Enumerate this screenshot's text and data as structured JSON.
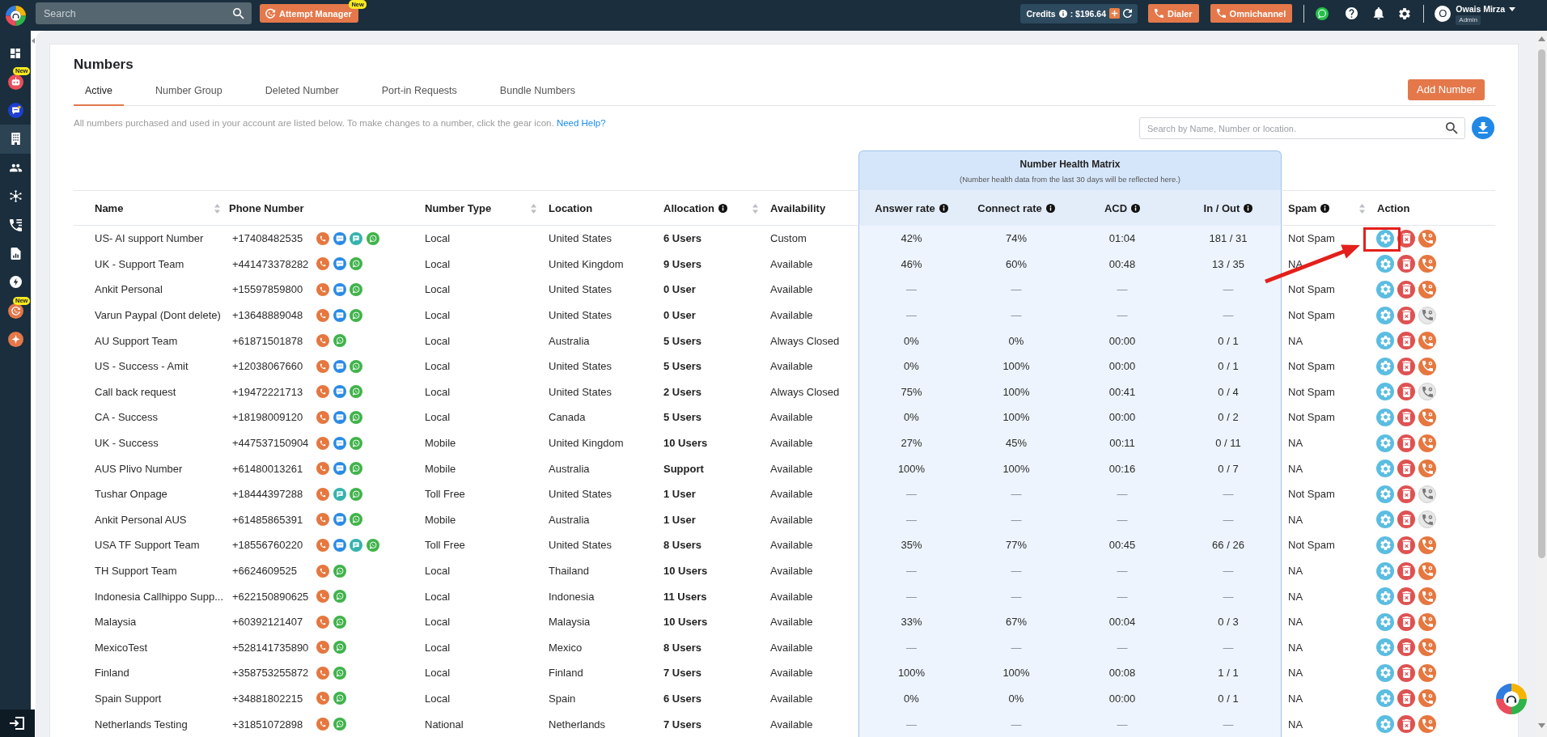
{
  "topbar": {
    "search": {
      "placeholder": "Search"
    },
    "attempt_manager": {
      "label": "Attempt Manager",
      "badge": "New"
    },
    "credits": {
      "label": "Credits",
      "amount": ": $196.64"
    },
    "buttons": [
      {
        "label": "Dialer"
      },
      {
        "label": "Omnichannel"
      }
    ],
    "user": {
      "initial": "O",
      "name": "Owais Mirza",
      "role": "Admin"
    }
  },
  "sidebar": {
    "items": [
      {
        "kind": "dashboard",
        "selected": false
      },
      {
        "kind": "bot",
        "selected": false,
        "badge": "New"
      },
      {
        "kind": "chat",
        "selected": false
      },
      {
        "kind": "building",
        "selected": true
      },
      {
        "kind": "people",
        "selected": false
      },
      {
        "kind": "network",
        "selected": false
      },
      {
        "kind": "phone-list",
        "selected": false
      },
      {
        "kind": "report",
        "selected": false
      },
      {
        "kind": "bolt",
        "selected": false
      },
      {
        "kind": "attempt",
        "selected": false,
        "badge": "New"
      },
      {
        "kind": "sparkle",
        "selected": false
      }
    ]
  },
  "page": {
    "title": "Numbers",
    "tabs": [
      {
        "label": "Active",
        "selected": true
      },
      {
        "label": "Number Group",
        "selected": false
      },
      {
        "label": "Deleted Number",
        "selected": false
      },
      {
        "label": "Port-in Requests",
        "selected": false
      },
      {
        "label": "Bundle Numbers",
        "selected": false
      }
    ],
    "add_button": "Add Number",
    "description": "All numbers purchased and used in your account are listed below. To make changes to a number, click the gear icon.",
    "help_link": "Need Help?",
    "search": {
      "placeholder": "Search by Name, Number or location."
    }
  },
  "health_matrix": {
    "title": "Number Health Matrix",
    "subtitle": "(Number health data from the last 30 days will be reflected here.)"
  },
  "table": {
    "columns": [
      {
        "label": "Name",
        "sortable": true,
        "info": false,
        "kind": "standard"
      },
      {
        "label": "Phone Number",
        "sortable": false,
        "info": false,
        "kind": "standard"
      },
      {
        "label": "Number Type",
        "sortable": true,
        "info": false,
        "kind": "standard"
      },
      {
        "label": "Location",
        "sortable": false,
        "info": false,
        "kind": "standard"
      },
      {
        "label": "Allocation",
        "sortable": true,
        "info": true,
        "kind": "standard"
      },
      {
        "label": "Availability",
        "sortable": false,
        "info": false,
        "kind": "standard"
      },
      {
        "label": "Answer rate",
        "sortable": false,
        "info": true,
        "kind": "health"
      },
      {
        "label": "Connect rate",
        "sortable": false,
        "info": true,
        "kind": "health"
      },
      {
        "label": "ACD",
        "sortable": false,
        "info": true,
        "kind": "health"
      },
      {
        "label": "In / Out",
        "sortable": false,
        "info": true,
        "kind": "health"
      },
      {
        "label": "Spam",
        "sortable": true,
        "info": true,
        "kind": "standard"
      },
      {
        "label": "Action",
        "sortable": false,
        "info": false,
        "kind": "standard"
      }
    ],
    "rows": [
      {
        "name": "US- AI support Number",
        "phone": "+17408482535",
        "channels": [
          {
            "kind": "call"
          },
          {
            "kind": "sms"
          },
          {
            "kind": "chat"
          },
          {
            "kind": "whatsapp"
          }
        ],
        "number_type": "Local",
        "location": "United States",
        "allocation": "6 Users",
        "availability": "Custom",
        "health_data": true,
        "answer_rate": "42%",
        "connect_rate": "74%",
        "acd": "01:04",
        "in_out": "181 / 31",
        "spam": "Not Spam",
        "forwarding": true,
        "highlighted": true
      },
      {
        "name": "UK - Support Team",
        "phone": "+441473378282",
        "channels": [
          {
            "kind": "call"
          },
          {
            "kind": "sms"
          },
          {
            "kind": "whatsapp"
          }
        ],
        "number_type": "Local",
        "location": "United Kingdom",
        "allocation": "9 Users",
        "availability": "Available",
        "health_data": true,
        "answer_rate": "46%",
        "connect_rate": "60%",
        "acd": "00:48",
        "in_out": "13 / 35",
        "spam": "NA",
        "forwarding": true,
        "highlighted": false
      },
      {
        "name": "Ankit Personal",
        "phone": "+15597859800",
        "channels": [
          {
            "kind": "call"
          },
          {
            "kind": "sms"
          },
          {
            "kind": "whatsapp"
          }
        ],
        "number_type": "Local",
        "location": "United States",
        "allocation": "0 User",
        "availability": "Available",
        "health_data": false,
        "answer_rate": "—",
        "connect_rate": "—",
        "acd": "—",
        "in_out": "—",
        "spam": "Not Spam",
        "forwarding": true,
        "highlighted": false
      },
      {
        "name": "Varun Paypal (Dont delete)",
        "phone": "+13648889048",
        "channels": [
          {
            "kind": "call"
          },
          {
            "kind": "sms"
          },
          {
            "kind": "whatsapp"
          }
        ],
        "number_type": "Local",
        "location": "United States",
        "allocation": "0 User",
        "availability": "Available",
        "health_data": false,
        "answer_rate": "—",
        "connect_rate": "—",
        "acd": "—",
        "in_out": "—",
        "spam": "Not Spam",
        "forwarding": false,
        "highlighted": false
      },
      {
        "name": "AU Support Team",
        "phone": "+61871501878",
        "channels": [
          {
            "kind": "call"
          },
          {
            "kind": "whatsapp"
          }
        ],
        "number_type": "Local",
        "location": "Australia",
        "allocation": "5 Users",
        "availability": "Always Closed",
        "health_data": true,
        "answer_rate": "0%",
        "connect_rate": "0%",
        "acd": "00:00",
        "in_out": "0 / 1",
        "spam": "NA",
        "forwarding": true,
        "highlighted": false
      },
      {
        "name": "US - Success - Amit",
        "phone": "+12038067660",
        "channels": [
          {
            "kind": "call"
          },
          {
            "kind": "sms"
          },
          {
            "kind": "whatsapp"
          }
        ],
        "number_type": "Local",
        "location": "United States",
        "allocation": "5 Users",
        "availability": "Available",
        "health_data": true,
        "answer_rate": "0%",
        "connect_rate": "100%",
        "acd": "00:00",
        "in_out": "0 / 1",
        "spam": "Not Spam",
        "forwarding": true,
        "highlighted": false
      },
      {
        "name": "Call back request",
        "phone": "+19472221713",
        "channels": [
          {
            "kind": "call"
          },
          {
            "kind": "sms"
          },
          {
            "kind": "whatsapp"
          }
        ],
        "number_type": "Local",
        "location": "United States",
        "allocation": "2 Users",
        "availability": "Always Closed",
        "health_data": true,
        "answer_rate": "75%",
        "connect_rate": "100%",
        "acd": "00:41",
        "in_out": "0 / 4",
        "spam": "Not Spam",
        "forwarding": false,
        "highlighted": false
      },
      {
        "name": "CA - Success",
        "phone": "+18198009120",
        "channels": [
          {
            "kind": "call"
          },
          {
            "kind": "sms"
          },
          {
            "kind": "whatsapp"
          }
        ],
        "number_type": "Local",
        "location": "Canada",
        "allocation": "5 Users",
        "availability": "Available",
        "health_data": true,
        "answer_rate": "0%",
        "connect_rate": "100%",
        "acd": "00:00",
        "in_out": "0 / 2",
        "spam": "Not Spam",
        "forwarding": true,
        "highlighted": false
      },
      {
        "name": "UK - Success",
        "phone": "+447537150904",
        "channels": [
          {
            "kind": "call"
          },
          {
            "kind": "sms"
          },
          {
            "kind": "whatsapp"
          }
        ],
        "number_type": "Mobile",
        "location": "United Kingdom",
        "allocation": "10 Users",
        "availability": "Available",
        "health_data": true,
        "answer_rate": "27%",
        "connect_rate": "45%",
        "acd": "00:11",
        "in_out": "0 / 11",
        "spam": "NA",
        "forwarding": true,
        "highlighted": false
      },
      {
        "name": "AUS Plivo Number",
        "phone": "+61480013261",
        "channels": [
          {
            "kind": "call"
          },
          {
            "kind": "sms"
          },
          {
            "kind": "whatsapp"
          }
        ],
        "number_type": "Mobile",
        "location": "Australia",
        "allocation": "Support",
        "availability": "Available",
        "health_data": true,
        "answer_rate": "100%",
        "connect_rate": "100%",
        "acd": "00:16",
        "in_out": "0 / 7",
        "spam": "NA",
        "forwarding": true,
        "highlighted": false
      },
      {
        "name": "Tushar Onpage",
        "phone": "+18444397288",
        "channels": [
          {
            "kind": "call"
          },
          {
            "kind": "chat"
          },
          {
            "kind": "whatsapp"
          }
        ],
        "number_type": "Toll Free",
        "location": "United States",
        "allocation": "1 User",
        "availability": "Available",
        "health_data": false,
        "answer_rate": "—",
        "connect_rate": "—",
        "acd": "—",
        "in_out": "—",
        "spam": "Not Spam",
        "forwarding": false,
        "highlighted": false
      },
      {
        "name": "Ankit Personal AUS",
        "phone": "+61485865391",
        "channels": [
          {
            "kind": "call"
          },
          {
            "kind": "sms"
          },
          {
            "kind": "whatsapp"
          }
        ],
        "number_type": "Mobile",
        "location": "Australia",
        "allocation": "1 User",
        "availability": "Available",
        "health_data": false,
        "answer_rate": "—",
        "connect_rate": "—",
        "acd": "—",
        "in_out": "—",
        "spam": "NA",
        "forwarding": false,
        "highlighted": false
      },
      {
        "name": "USA TF Support Team",
        "phone": "+18556760220",
        "channels": [
          {
            "kind": "call"
          },
          {
            "kind": "sms"
          },
          {
            "kind": "chat"
          },
          {
            "kind": "whatsapp"
          }
        ],
        "number_type": "Toll Free",
        "location": "United States",
        "allocation": "8 Users",
        "availability": "Available",
        "health_data": true,
        "answer_rate": "35%",
        "connect_rate": "77%",
        "acd": "00:45",
        "in_out": "66 / 26",
        "spam": "Not Spam",
        "forwarding": true,
        "highlighted": false
      },
      {
        "name": "TH Support Team",
        "phone": "+6624609525",
        "channels": [
          {
            "kind": "call"
          },
          {
            "kind": "whatsapp"
          }
        ],
        "number_type": "Local",
        "location": "Thailand",
        "allocation": "10 Users",
        "availability": "Available",
        "health_data": false,
        "answer_rate": "—",
        "connect_rate": "—",
        "acd": "—",
        "in_out": "—",
        "spam": "NA",
        "forwarding": true,
        "highlighted": false
      },
      {
        "name": "Indonesia Callhippo Supp...",
        "phone": "+622150890625",
        "channels": [
          {
            "kind": "call"
          },
          {
            "kind": "whatsapp"
          }
        ],
        "number_type": "Local",
        "location": "Indonesia",
        "allocation": "11 Users",
        "availability": "Available",
        "health_data": false,
        "answer_rate": "—",
        "connect_rate": "—",
        "acd": "—",
        "in_out": "—",
        "spam": "NA",
        "forwarding": true,
        "highlighted": false
      },
      {
        "name": "Malaysia",
        "phone": "+60392121407",
        "channels": [
          {
            "kind": "call"
          },
          {
            "kind": "whatsapp"
          }
        ],
        "number_type": "Local",
        "location": "Malaysia",
        "allocation": "10 Users",
        "availability": "Available",
        "health_data": true,
        "answer_rate": "33%",
        "connect_rate": "67%",
        "acd": "00:04",
        "in_out": "0 / 3",
        "spam": "NA",
        "forwarding": true,
        "highlighted": false
      },
      {
        "name": "MexicoTest",
        "phone": "+528141735890",
        "channels": [
          {
            "kind": "call"
          },
          {
            "kind": "whatsapp"
          }
        ],
        "number_type": "Local",
        "location": "Mexico",
        "allocation": "8 Users",
        "availability": "Available",
        "health_data": false,
        "answer_rate": "—",
        "connect_rate": "—",
        "acd": "—",
        "in_out": "—",
        "spam": "NA",
        "forwarding": true,
        "highlighted": false
      },
      {
        "name": "Finland",
        "phone": "+358753255872",
        "channels": [
          {
            "kind": "call"
          },
          {
            "kind": "whatsapp"
          }
        ],
        "number_type": "Local",
        "location": "Finland",
        "allocation": "7 Users",
        "availability": "Available",
        "health_data": true,
        "answer_rate": "100%",
        "connect_rate": "100%",
        "acd": "00:08",
        "in_out": "1 / 1",
        "spam": "NA",
        "forwarding": true,
        "highlighted": false
      },
      {
        "name": "Spain Support",
        "phone": "+34881802215",
        "channels": [
          {
            "kind": "call"
          },
          {
            "kind": "whatsapp"
          }
        ],
        "number_type": "Local",
        "location": "Spain",
        "allocation": "6 Users",
        "availability": "Available",
        "health_data": true,
        "answer_rate": "0%",
        "connect_rate": "0%",
        "acd": "00:00",
        "in_out": "0 / 1",
        "spam": "NA",
        "forwarding": true,
        "highlighted": false
      },
      {
        "name": "Netherlands Testing",
        "phone": "+31851072898",
        "channels": [
          {
            "kind": "call"
          },
          {
            "kind": "whatsapp"
          }
        ],
        "number_type": "National",
        "location": "Netherlands",
        "allocation": "7 Users",
        "availability": "Available",
        "health_data": false,
        "answer_rate": "—",
        "connect_rate": "—",
        "acd": "—",
        "in_out": "—",
        "spam": "NA",
        "forwarding": true,
        "highlighted": false
      }
    ]
  }
}
